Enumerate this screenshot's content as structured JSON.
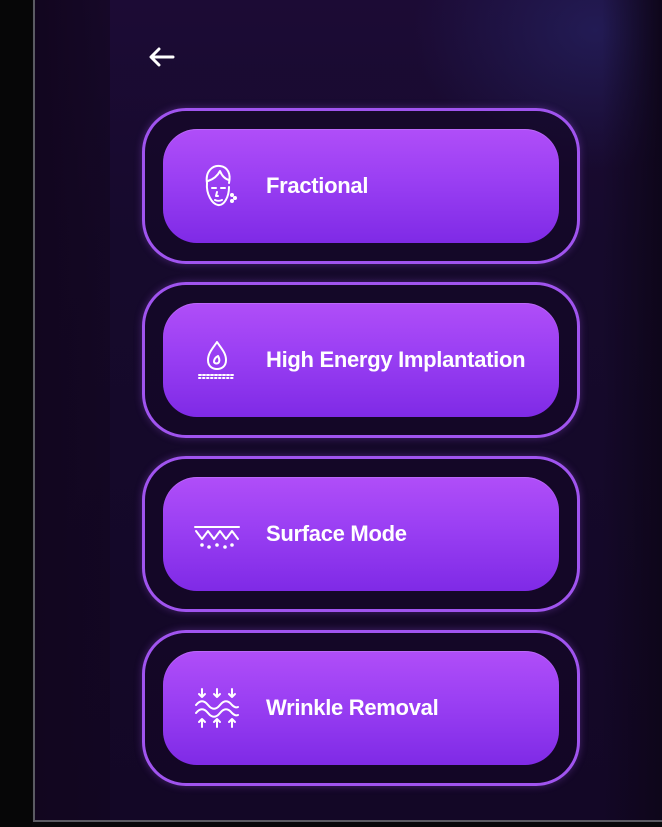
{
  "header": {
    "back_icon": "arrow-left-icon"
  },
  "modes": [
    {
      "label": "Fractional",
      "icon": "face-icon"
    },
    {
      "label": "High Energy Implantation",
      "icon": "droplet-icon"
    },
    {
      "label": "Surface Mode",
      "icon": "surface-wave-icon"
    },
    {
      "label": "Wrinkle Removal",
      "icon": "wrinkle-wave-icon"
    }
  ],
  "colors": {
    "accent": "#a054ef",
    "button_top": "#b04ef8",
    "button_bottom": "#7f2ae6",
    "background": "#160a2c"
  }
}
